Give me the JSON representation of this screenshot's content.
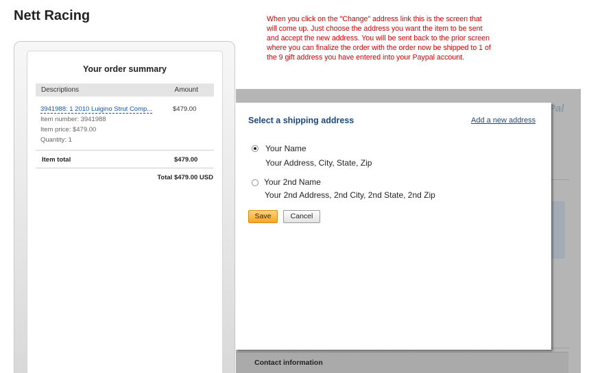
{
  "store": {
    "title": "Nett Racing"
  },
  "note": {
    "text": "When you click on the \"Change\" address link this is the screen that will come up. Just choose the address you want the item to be sent and accept the new address. You will be sent back to the prior screen where you can finalize the order with the order now be shipped to 1 of the 9 gift address you have entered into your Paypal account."
  },
  "summary": {
    "title": "Your order summary",
    "col_descriptions": "Descriptions",
    "col_amount": "Amount",
    "item": {
      "link": "3941988: 1 2010 Luigino Strut Comp...",
      "price": "$479.00",
      "number": "Item number: 3941988",
      "item_price": "Item price: $479.00",
      "quantity": "Quantity: 1"
    },
    "item_total_label": "Item total",
    "item_total_value": "$479.00",
    "grand_total": "Total $479.00 USD"
  },
  "paypal": {
    "logo": "Pal",
    "contact_label": "Contact information"
  },
  "modal": {
    "title": "Select a shipping address",
    "add_link": "Add a new address",
    "addresses": [
      {
        "name": "Your Name",
        "line": "Your Address, City, State, Zip",
        "selected": true
      },
      {
        "name": "Your 2nd Name",
        "line": "Your 2nd Address, 2nd City, 2nd State, 2nd Zip",
        "selected": false
      }
    ],
    "save_label": "Save",
    "cancel_label": "Cancel"
  },
  "colors": {
    "note_red": "#d40000",
    "link_blue": "#1a52a8",
    "title_blue": "#1b4a7a",
    "save_orange": "#f5a623"
  }
}
